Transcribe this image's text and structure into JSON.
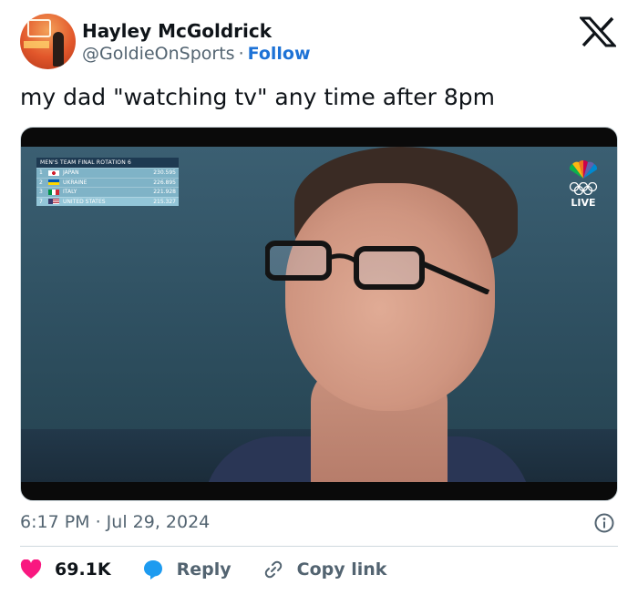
{
  "author": {
    "name": "Hayley McGoldrick",
    "handle": "@GoldieOnSports",
    "separator": "·",
    "follow_label": "Follow"
  },
  "tweet": {
    "text": "my dad \"watching tv\" any time after 8pm",
    "timestamp": "6:17 PM · Jul 29, 2024"
  },
  "media": {
    "scoreboard": {
      "header": "MEN'S TEAM FINAL  ROTATION 6",
      "rows": [
        {
          "rank": "1",
          "country": "JAPAN",
          "points": "230.595"
        },
        {
          "rank": "2",
          "country": "UKRAINE",
          "points": "226.895"
        },
        {
          "rank": "3",
          "country": "ITALY",
          "points": "221.928"
        },
        {
          "rank": "7",
          "country": "UNITED STATES",
          "points": "215.327"
        }
      ]
    },
    "broadcast_badge": "LIVE"
  },
  "actions": {
    "likes": "69.1K",
    "reply_label": "Reply",
    "copy_link_label": "Copy link"
  },
  "colors": {
    "like": "#f91880",
    "reply": "#1d9bf0",
    "follow": "#1d72d6",
    "muted": "#536471"
  },
  "icons": [
    "x-logo-icon",
    "heart-icon",
    "reply-bubble-icon",
    "link-icon",
    "info-icon"
  ]
}
